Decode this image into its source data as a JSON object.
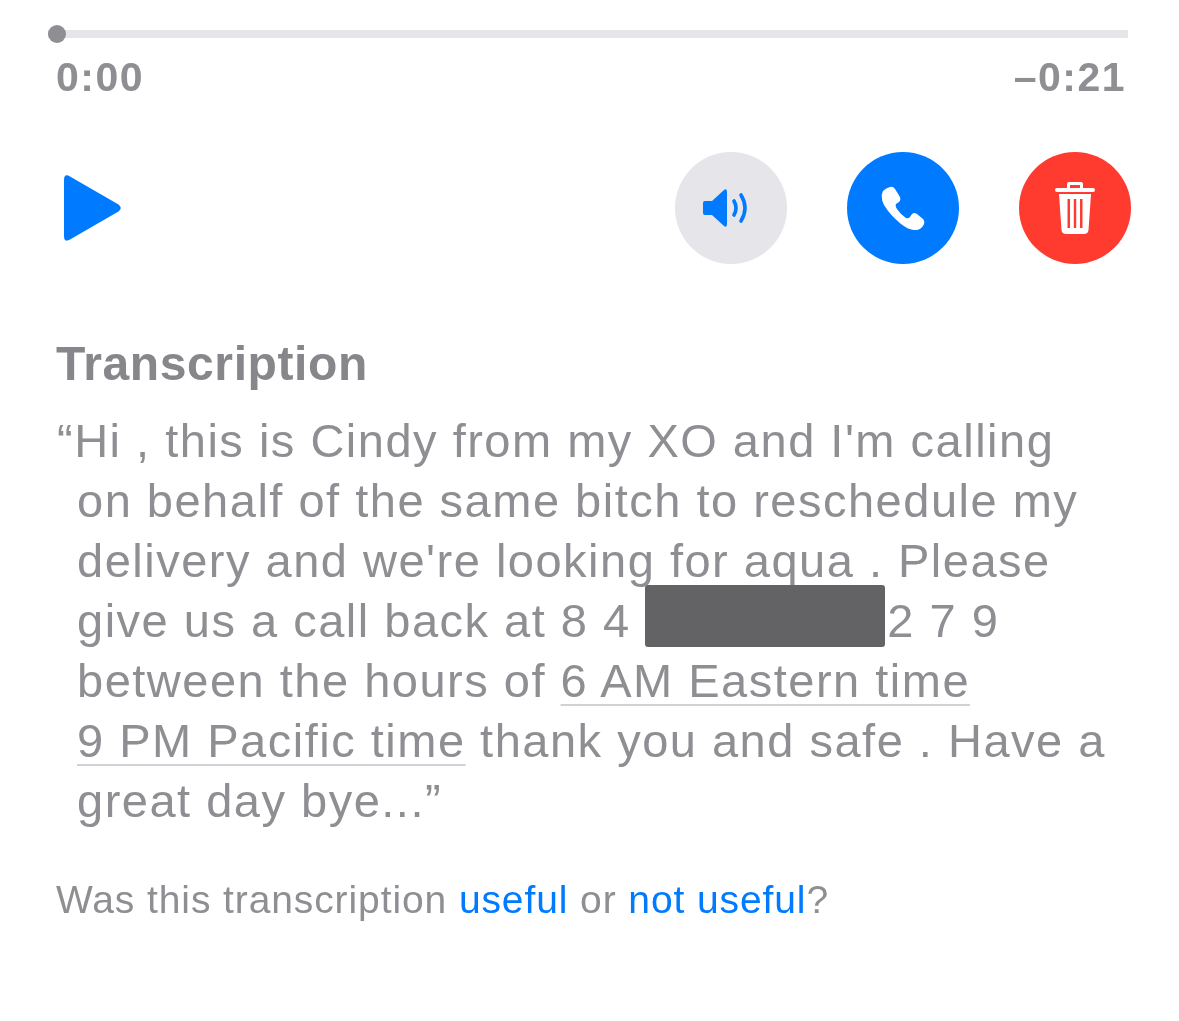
{
  "player": {
    "progress": {
      "level": 0
    },
    "elapsed": "0:00",
    "remaining": "–0:21"
  },
  "actions": [
    {
      "kind": "play"
    },
    {
      "kind": "speaker",
      "on": false
    },
    {
      "kind": "call"
    },
    {
      "kind": "delete"
    }
  ],
  "transcription": {
    "heading": "Transcription",
    "segments": [
      {
        "kind": "text",
        "text": "“Hi , this is Cindy from my XO and I'm calling on behalf of the same bitch to reschedule my delivery and we're looking for aqua . Please give us a call back at 8 4 "
      },
      {
        "kind": "redaction"
      },
      {
        "kind": "text",
        "text": "2 7 9 between the hours of "
      },
      {
        "kind": "link",
        "text": "6 AM Eastern time"
      },
      {
        "kind": "gap"
      },
      {
        "kind": "link",
        "text": "9 PM Pacific time"
      },
      {
        "kind": "text",
        "text": " thank you and safe . Have a great day bye...”"
      }
    ]
  },
  "feedback": {
    "segments": [
      {
        "kind": "text",
        "text": "Was this transcription "
      },
      {
        "kind": "link",
        "text": "useful"
      },
      {
        "kind": "text",
        "text": " or "
      },
      {
        "kind": "link",
        "text": "not useful"
      },
      {
        "kind": "text",
        "text": "?"
      }
    ]
  }
}
